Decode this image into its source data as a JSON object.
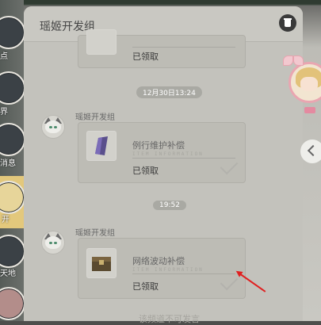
{
  "rail": {
    "items": [
      {
        "label": "点"
      },
      {
        "label": "界"
      },
      {
        "label": "消息"
      },
      {
        "label": "开"
      },
      {
        "label": "天地"
      }
    ]
  },
  "panel": {
    "title": "瑶姬开发组"
  },
  "messages": [
    {
      "item_name": "",
      "watermark": "",
      "status": "已领取"
    },
    {
      "timestamp": "12月30日13:24",
      "sender": "瑶姬开发组",
      "item_name": "例行维护补偿",
      "watermark": "ITEM INFORMATION",
      "status": "已领取"
    },
    {
      "timestamp": "19:52",
      "sender": "瑶姬开发组",
      "item_name": "网络波动补偿",
      "watermark": "ITEM INFORMATION",
      "status": "已领取"
    }
  ],
  "footer": {
    "text": "该频道不可发言"
  },
  "colors": {
    "annotation_arrow": "#e02020",
    "active_rail": "#e3c87c"
  }
}
